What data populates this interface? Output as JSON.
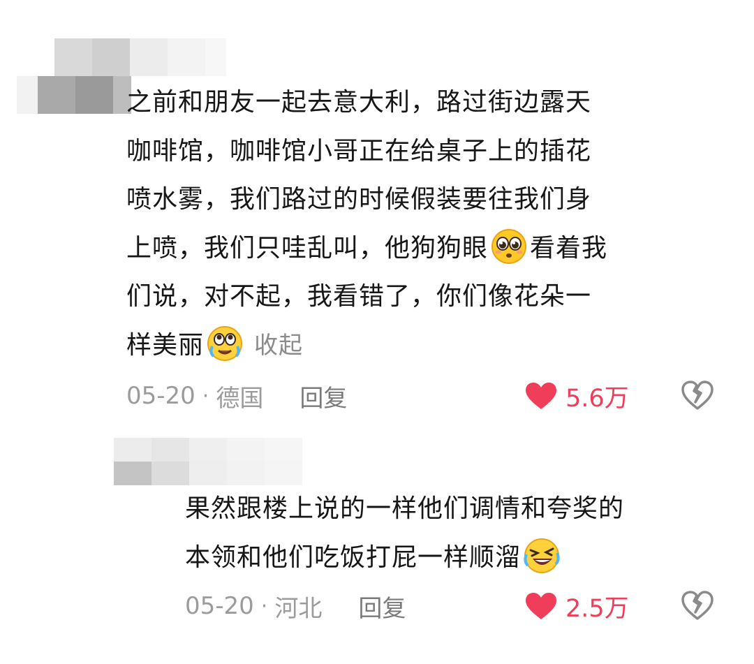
{
  "comments": [
    {
      "lines": [
        "之前和朋友一起去意大利，路过街边露天",
        "咖啡馆，咖啡馆小哥正在给桌子上的插花",
        "喷水雾，我们路过的时候假装要往我们身"
      ],
      "line4_before": "上喷，我们只哇乱叫，他狗狗眼",
      "line4_after": "看着我",
      "line5": "们说，对不起，我看错了，你们像花朵一",
      "line6_text": "样美丽",
      "collapse_label": "收起",
      "emoji_1": "pleading-face-icon",
      "emoji_2": "tearful-face-icon",
      "date": "05-20",
      "location": "德国",
      "reply_label": "回复",
      "likes": "5.6万"
    },
    {
      "line1": "果然跟楼上说的一样他们调情和夸奖的",
      "line2": "本领和他们吃饭打屁一样顺溜",
      "emoji": "rolling-laughing-icon",
      "date": "05-20",
      "location": "河北",
      "reply_label": "回复",
      "likes": "2.5万"
    }
  ],
  "separator": "·",
  "colors": {
    "like": "#ef3d5a",
    "meta": "#9b9b9b",
    "text": "#161616"
  }
}
